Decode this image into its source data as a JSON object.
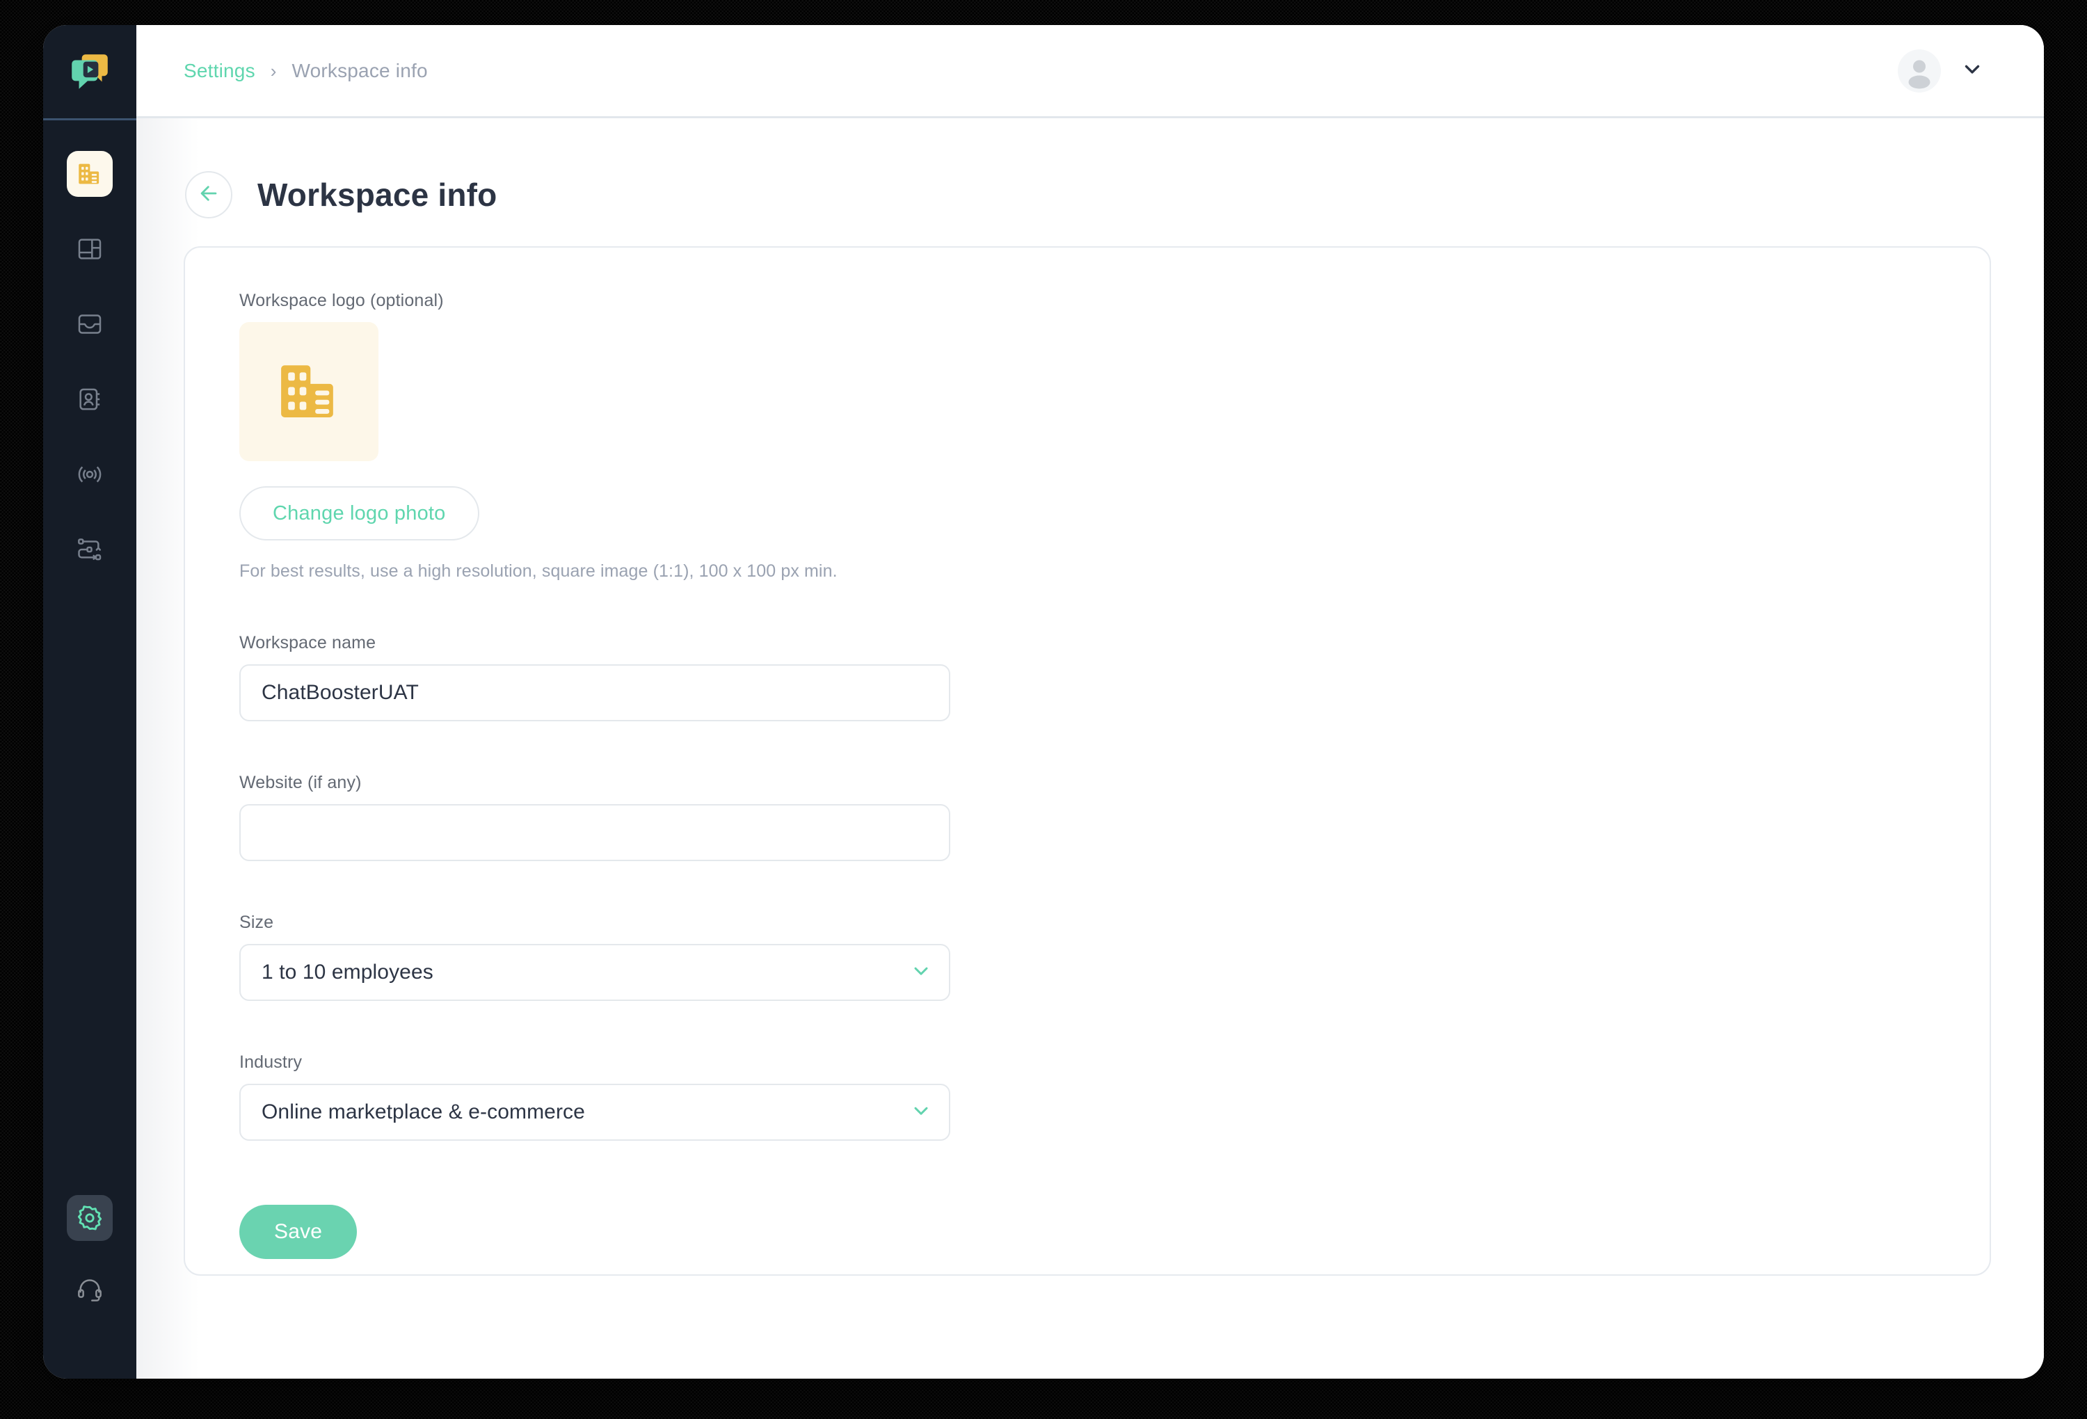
{
  "brand": {
    "logo_icon": "chatbooster-logo-icon"
  },
  "header": {
    "breadcrumb": {
      "parent": "Settings",
      "separator": "›",
      "current": "Workspace info"
    },
    "user_menu": {
      "avatar_icon": "user-avatar-icon",
      "chevron_icon": "chevron-down-icon"
    }
  },
  "sidebar": {
    "items": [
      {
        "icon": "building-icon",
        "name": "workspace",
        "active": true
      },
      {
        "icon": "dashboard-icon",
        "name": "dashboard",
        "active": false
      },
      {
        "icon": "inbox-icon",
        "name": "inbox",
        "active": false
      },
      {
        "icon": "contacts-icon",
        "name": "contacts",
        "active": false
      },
      {
        "icon": "broadcast-icon",
        "name": "broadcast",
        "active": false
      },
      {
        "icon": "workflow-icon",
        "name": "automation",
        "active": false
      }
    ],
    "bottom_items": [
      {
        "icon": "gear-icon",
        "name": "settings",
        "active": true
      },
      {
        "icon": "headset-icon",
        "name": "support",
        "active": false
      }
    ]
  },
  "page": {
    "back_icon": "arrow-left-icon",
    "title": "Workspace info"
  },
  "form": {
    "logo": {
      "label": "Workspace logo (optional)",
      "icon": "building-icon",
      "change_button": "Change logo photo",
      "hint": "For best results, use a high resolution, square image (1:1), 100 x 100 px min."
    },
    "workspace_name": {
      "label": "Workspace name",
      "value": "ChatBoosterUAT",
      "placeholder": ""
    },
    "website": {
      "label": "Website (if any)",
      "value": "",
      "placeholder": ""
    },
    "size": {
      "label": "Size",
      "value": "1 to 10 employees",
      "chevron_icon": "chevron-down-icon"
    },
    "industry": {
      "label": "Industry",
      "value": "Online marketplace & e-commerce",
      "chevron_icon": "chevron-down-icon"
    },
    "save_label": "Save"
  },
  "colors": {
    "accent_green": "#5fd6ae",
    "save_green": "#6ad3b0",
    "amber": "#ecb944",
    "amber_tile": "#fdf7e9",
    "rail_dark": "#151c27",
    "text_dark": "#2c3444",
    "text_muted": "#9aa2b1"
  }
}
